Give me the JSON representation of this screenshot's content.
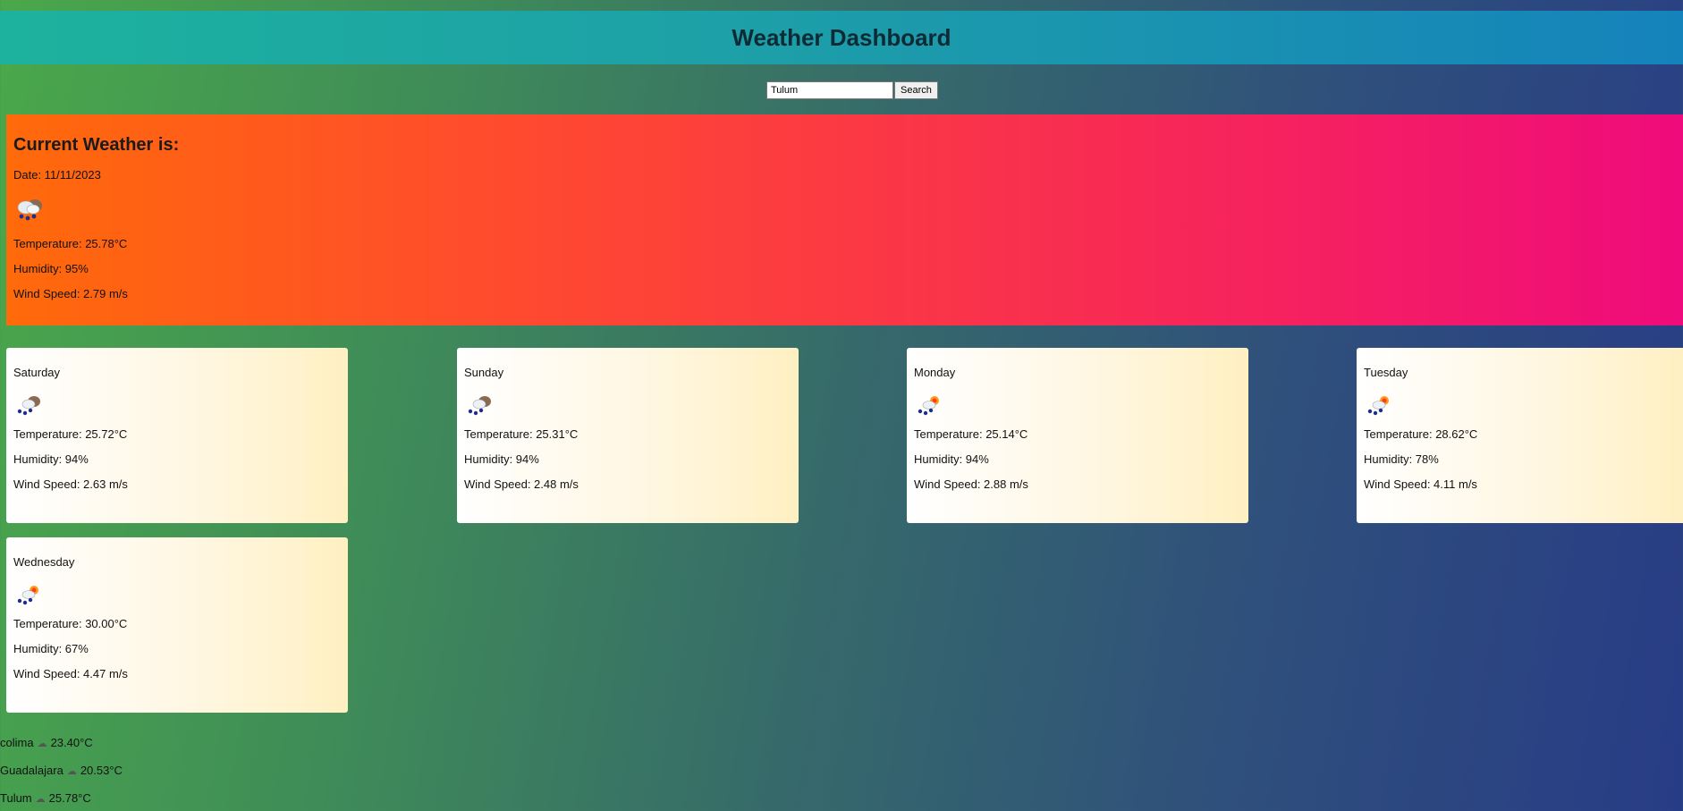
{
  "header": {
    "title": "Weather Dashboard"
  },
  "search": {
    "value": "Tulum",
    "button_label": "Search"
  },
  "current": {
    "title": "Current Weather is:",
    "date": "Date: 11/11/2023",
    "icon": "cloud-rain-icon",
    "temperature": "Temperature: 25.78°C",
    "humidity": "Humidity: 95%",
    "wind": "Wind Speed: 2.79 m/s"
  },
  "forecast": [
    {
      "day": "Saturday",
      "icon": "cloud-rain-icon",
      "temperature": "Temperature: 25.72°C",
      "humidity": "Humidity: 94%",
      "wind": "Wind Speed: 2.63 m/s"
    },
    {
      "day": "Sunday",
      "icon": "cloud-rain-icon",
      "temperature": "Temperature: 25.31°C",
      "humidity": "Humidity: 94%",
      "wind": "Wind Speed: 2.48 m/s"
    },
    {
      "day": "Monday",
      "icon": "sun-rain-icon",
      "temperature": "Temperature: 25.14°C",
      "humidity": "Humidity: 94%",
      "wind": "Wind Speed: 2.88 m/s"
    },
    {
      "day": "Tuesday",
      "icon": "sun-rain-icon",
      "temperature": "Temperature: 28.62°C",
      "humidity": "Humidity: 78%",
      "wind": "Wind Speed: 4.11 m/s"
    },
    {
      "day": "Wednesday",
      "icon": "sun-rain-icon",
      "temperature": "Temperature: 30.00°C",
      "humidity": "Humidity: 67%",
      "wind": "Wind Speed: 4.47 m/s"
    }
  ],
  "recent": [
    {
      "city": "colima",
      "icon": "cloud-icon",
      "temp": "23.40°C"
    },
    {
      "city": "Guadalajara",
      "icon": "cloud-icon",
      "temp": "20.53°C"
    },
    {
      "city": "Tulum",
      "icon": "cloud-icon",
      "temp": "25.78°C"
    }
  ]
}
